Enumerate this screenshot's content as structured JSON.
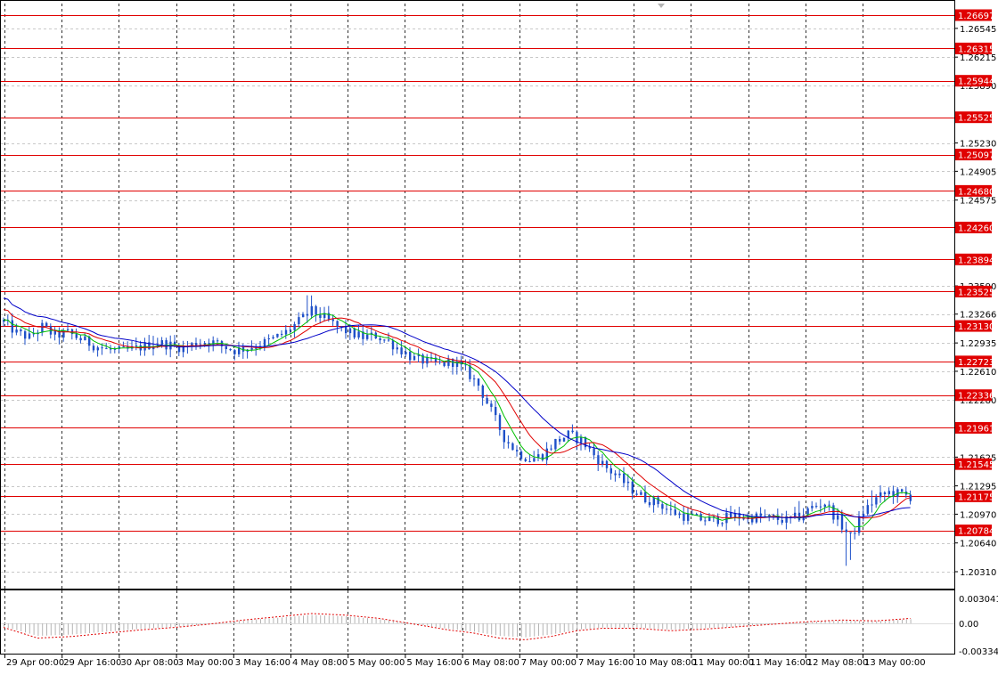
{
  "colors": {
    "background": "#ffffff",
    "grid": "#c8c8c8",
    "candle": "#1e50c8",
    "level_line": "#e00000",
    "level_label_bg": "#e00000",
    "ma_fast": "#00c000",
    "ma_mid": "#e00000",
    "ma_slow": "#0000c8",
    "oscillator_bars": "#b4b4b4",
    "oscillator_signal": "#e00000"
  },
  "chart_data": [
    {
      "type": "candlestick",
      "title": "",
      "grid": true,
      "ylim": [
        1.2015,
        1.269
      ],
      "y_ticks": [
        "1.26545",
        "1.26215",
        "1.25890",
        "1.25230",
        "1.24905",
        "1.24575",
        "1.23590",
        "1.23266",
        "1.22935",
        "1.22610",
        "1.22280",
        "1.21625",
        "1.21295",
        "1.20970",
        "1.20640",
        "1.20310"
      ],
      "levels": [
        "1.26697",
        "1.26315",
        "1.25944",
        "1.25525",
        "1.25097",
        "1.24680",
        "1.24260",
        "1.23894",
        "1.23525",
        "1.23130",
        "1.22723",
        "1.22336",
        "1.21961",
        "1.21545",
        "1.21175",
        "1.20784"
      ],
      "x_labels": [
        "29 Apr 00:00",
        "29 Apr 16:00",
        "30 Apr 08:00",
        "3 May 00:00",
        "3 May 16:00",
        "4 May 08:00",
        "5 May 00:00",
        "5 May 16:00",
        "6 May 08:00",
        "7 May 00:00",
        "7 May 16:00",
        "10 May 08:00",
        "11 May 00:00",
        "11 May 16:00",
        "12 May 08:00",
        "13 May 00:00"
      ],
      "price_path": [
        [
          0,
          1.2318
        ],
        [
          3,
          1.2305
        ],
        [
          6,
          1.23
        ],
        [
          9,
          1.2312
        ],
        [
          12,
          1.2302
        ],
        [
          15,
          1.2305
        ],
        [
          18,
          1.2298
        ],
        [
          21,
          1.2291
        ],
        [
          24,
          1.2286
        ],
        [
          27,
          1.2284
        ],
        [
          30,
          1.2286
        ],
        [
          33,
          1.229
        ],
        [
          36,
          1.2294
        ],
        [
          39,
          1.2291
        ],
        [
          42,
          1.2288
        ],
        [
          45,
          1.2293
        ],
        [
          48,
          1.2296
        ],
        [
          51,
          1.229
        ],
        [
          54,
          1.2285
        ],
        [
          57,
          1.2288
        ],
        [
          60,
          1.2292
        ],
        [
          63,
          1.2298
        ],
        [
          66,
          1.2306
        ],
        [
          69,
          1.2318
        ],
        [
          72,
          1.233
        ],
        [
          75,
          1.2322
        ],
        [
          78,
          1.2312
        ],
        [
          81,
          1.2305
        ],
        [
          84,
          1.23
        ],
        [
          87,
          1.2302
        ],
        [
          90,
          1.2295
        ],
        [
          93,
          1.2285
        ],
        [
          96,
          1.2275
        ],
        [
          99,
          1.2272
        ],
        [
          102,
          1.2269
        ],
        [
          105,
          1.2272
        ],
        [
          108,
          1.2262
        ],
        [
          111,
          1.2245
        ],
        [
          114,
          1.2215
        ],
        [
          117,
          1.2185
        ],
        [
          120,
          1.2168
        ],
        [
          123,
          1.216
        ],
        [
          126,
          1.2165
        ],
        [
          129,
          1.218
        ],
        [
          132,
          1.2188
        ],
        [
          135,
          1.2182
        ],
        [
          138,
          1.2165
        ],
        [
          141,
          1.215
        ],
        [
          144,
          1.2138
        ],
        [
          147,
          1.2125
        ],
        [
          150,
          1.2115
        ],
        [
          153,
          1.211
        ],
        [
          156,
          1.21
        ],
        [
          159,
          1.2095
        ],
        [
          162,
          1.2092
        ],
        [
          165,
          1.209
        ],
        [
          168,
          1.2092
        ],
        [
          171,
          1.2095
        ],
        [
          174,
          1.2093
        ],
        [
          177,
          1.2094
        ],
        [
          180,
          1.2092
        ],
        [
          183,
          1.209
        ],
        [
          186,
          1.2094
        ],
        [
          189,
          1.2105
        ],
        [
          192,
          1.211
        ],
        [
          195,
          1.209
        ],
        [
          198,
          1.207
        ],
        [
          201,
          1.21
        ],
        [
          204,
          1.2115
        ],
        [
          207,
          1.2122
        ],
        [
          210,
          1.212
        ],
        [
          212,
          1.2117
        ]
      ]
    },
    {
      "type": "bar",
      "title": "",
      "y_ticks": [
        "0.003041",
        "0.00",
        "-0.003342"
      ],
      "ylim": [
        -0.003342,
        0.003041
      ],
      "signal_path": [
        [
          0,
          -0.0005
        ],
        [
          8,
          -0.0018
        ],
        [
          16,
          -0.0016
        ],
        [
          24,
          -0.0012
        ],
        [
          32,
          -0.0008
        ],
        [
          40,
          -0.0005
        ],
        [
          48,
          -0.0001
        ],
        [
          56,
          0.0004
        ],
        [
          64,
          0.0008
        ],
        [
          72,
          0.0012
        ],
        [
          80,
          0.001
        ],
        [
          88,
          0.0006
        ],
        [
          96,
          -0.0001
        ],
        [
          104,
          -0.0008
        ],
        [
          110,
          -0.0012
        ],
        [
          116,
          -0.0018
        ],
        [
          122,
          -0.002
        ],
        [
          128,
          -0.0016
        ],
        [
          134,
          -0.0009
        ],
        [
          140,
          -0.0006
        ],
        [
          148,
          -0.0006
        ],
        [
          156,
          -0.0009
        ],
        [
          164,
          -0.0007
        ],
        [
          172,
          -0.0004
        ],
        [
          180,
          -0.0001
        ],
        [
          188,
          0.0002
        ],
        [
          196,
          0.0004
        ],
        [
          204,
          0.0003
        ],
        [
          212,
          0.0006
        ]
      ]
    }
  ]
}
